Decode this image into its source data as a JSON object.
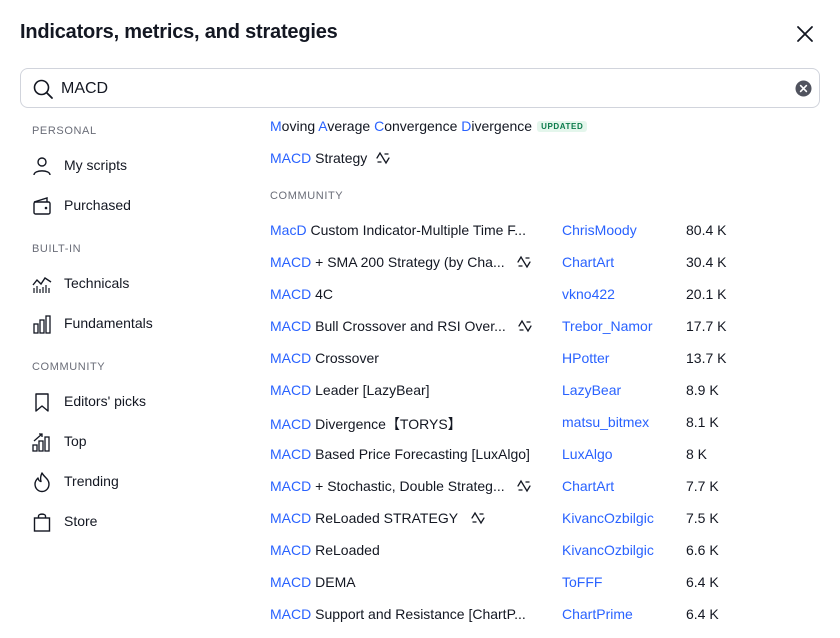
{
  "dialog": {
    "title": "Indicators, metrics, and strategies"
  },
  "search": {
    "value": "MACD"
  },
  "sidebar": {
    "sections": [
      {
        "label": "PERSONAL"
      },
      {
        "label": "BUILT-IN"
      },
      {
        "label": "COMMUNITY"
      }
    ],
    "items": [
      {
        "label": "My scripts",
        "icon": "user-icon"
      },
      {
        "label": "Purchased",
        "icon": "wallet-icon"
      },
      {
        "label": "Technicals",
        "icon": "technicals-chart-icon"
      },
      {
        "label": "Fundamentals",
        "icon": "fundamentals-bars-icon"
      },
      {
        "label": "Editors' picks",
        "icon": "bookmark-icon"
      },
      {
        "label": "Top",
        "icon": "top-chart-icon"
      },
      {
        "label": "Trending",
        "icon": "flame-icon"
      },
      {
        "label": "Store",
        "icon": "shopping-bag-icon"
      }
    ]
  },
  "builtin_results": [
    {
      "hl": [
        "M",
        "A",
        "C",
        "D"
      ],
      "rest": [
        "oving ",
        "verage ",
        "onvergence ",
        "ivergence"
      ],
      "badge": "UPDATED"
    },
    {
      "hl": "MACD",
      "rest": " Strategy",
      "strategy": true
    }
  ],
  "community_section_label": "COMMUNITY",
  "community_results": [
    {
      "hl": "MacD",
      "rest": " Custom Indicator-Multiple Time F...",
      "strategy": false,
      "author": "ChrisMoody",
      "likes": "80.4 K"
    },
    {
      "hl": "MACD",
      "rest": " + SMA 200 Strategy (by Cha...",
      "strategy": true,
      "author": "ChartArt",
      "likes": "30.4 K"
    },
    {
      "hl": "MACD",
      "rest": " 4C",
      "strategy": false,
      "author": "vkno422",
      "likes": "20.1 K"
    },
    {
      "hl": "MACD",
      "rest": " Bull Crossover and RSI Over...",
      "strategy": true,
      "author": "Trebor_Namor",
      "likes": "17.7 K"
    },
    {
      "hl": "MACD",
      "rest": " Crossover",
      "strategy": false,
      "author": "HPotter",
      "likes": "13.7 K"
    },
    {
      "hl": "MACD",
      "rest": " Leader [LazyBear]",
      "strategy": false,
      "author": "LazyBear",
      "likes": "8.9 K"
    },
    {
      "hl": "MACD",
      "rest": " Divergence【TORYS】",
      "strategy": false,
      "author": "matsu_bitmex",
      "likes": "8.1 K"
    },
    {
      "hl": "MACD",
      "rest": " Based Price Forecasting [LuxAlgo]",
      "strategy": false,
      "author": "LuxAlgo",
      "likes": "8 K"
    },
    {
      "hl": "MACD",
      "rest": " + Stochastic, Double Strateg...",
      "strategy": true,
      "author": "ChartArt",
      "likes": "7.7 K"
    },
    {
      "hl": "MACD",
      "rest": " ReLoaded STRATEGY",
      "strategy": true,
      "author": "KivancOzbilgic",
      "likes": "7.5 K"
    },
    {
      "hl": "MACD",
      "rest": " ReLoaded",
      "strategy": false,
      "author": "KivancOzbilgic",
      "likes": "6.6 K"
    },
    {
      "hl": "MACD",
      "rest": " DEMA",
      "strategy": false,
      "author": "ToFFF",
      "likes": "6.4 K"
    },
    {
      "hl": "MACD",
      "rest": " Support and Resistance [ChartP...",
      "strategy": false,
      "author": "ChartPrime",
      "likes": "6.4 K"
    }
  ],
  "colors": {
    "accent": "#2962ff",
    "text": "#131722",
    "muted": "#6a6d78",
    "border": "#d1d4dc",
    "badge_text": "#0a7a4a",
    "badge_bg": "#e4f6ec"
  }
}
